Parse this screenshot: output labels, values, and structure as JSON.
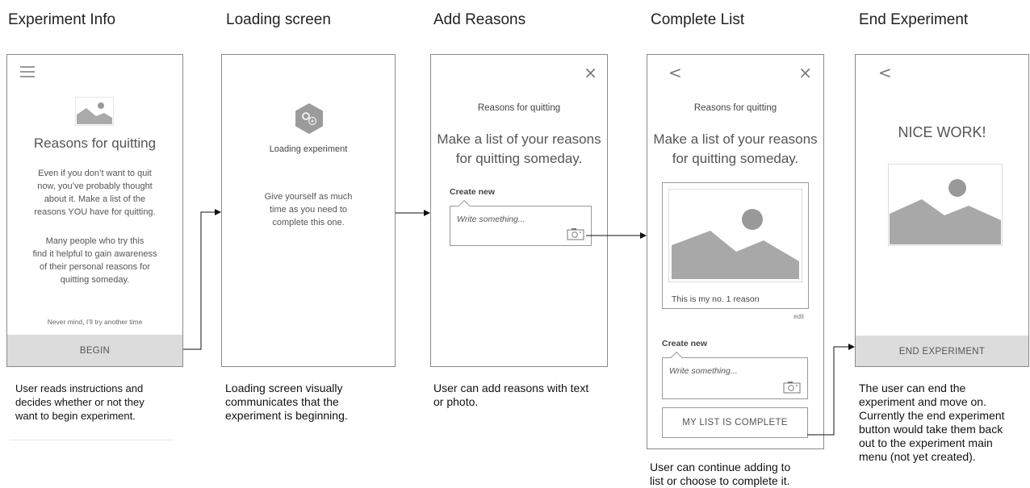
{
  "columns": [
    {
      "title": "Experiment Info"
    },
    {
      "title": "Loading screen"
    },
    {
      "title": "Add Reasons"
    },
    {
      "title": "Complete List"
    },
    {
      "title": "End Experiment"
    }
  ],
  "screen1": {
    "title": "Reasons for quitting",
    "para1": [
      "Even if you don’t want to quit",
      "now, you’ve probably thought",
      "about it. Make a list of the",
      "reasons YOU have for quitting."
    ],
    "para2": [
      "Many people who try this",
      "find it helpful to gain awareness",
      "of their personal reasons for",
      "quitting someday."
    ],
    "skip_link": "Never mind, I’ll try another time",
    "begin_button": "BEGIN"
  },
  "screen2": {
    "loading_label": "Loading experiment",
    "message": [
      "Give yourself as much",
      "time as you need to",
      "complete this one."
    ]
  },
  "screen3": {
    "header": "Reasons for quitting",
    "prompt": [
      "Make a list of your reasons",
      "for quitting someday."
    ],
    "create_label": "Create new",
    "input_placeholder": "Write something..."
  },
  "screen4": {
    "header": "Reasons for quitting",
    "prompt": [
      "Make a list of your reasons",
      "for quitting someday."
    ],
    "reason_caption": "This is my no. 1 reason",
    "edit_link": "edit",
    "create_label": "Create new",
    "input_placeholder": "Write something...",
    "complete_button": "MY LIST IS COMPLETE"
  },
  "screen5": {
    "heading": "NICE WORK!",
    "end_button": "END EXPERIMENT"
  },
  "captions": {
    "c1": [
      "User reads instructions and",
      "decides whether or not they",
      "want to begin experiment."
    ],
    "c2": [
      "Loading screen visually",
      "communicates that the",
      "experiment is beginning."
    ],
    "c3": [
      "User can add reasons with text",
      "or photo."
    ],
    "c4": [
      "User can continue adding to",
      "list or choose to complete it."
    ],
    "c5": [
      "The user can end the",
      "experiment and move on.",
      "Currently the end experiment",
      "button would take them back",
      "out to the experiment main",
      "menu (not yet created)."
    ]
  },
  "icons": {
    "menu": "hamburger-icon",
    "close": "close-icon",
    "back": "back-chevron-icon",
    "camera": "camera-icon",
    "image": "image-placeholder-icon",
    "loading": "loading-gear-icon"
  }
}
